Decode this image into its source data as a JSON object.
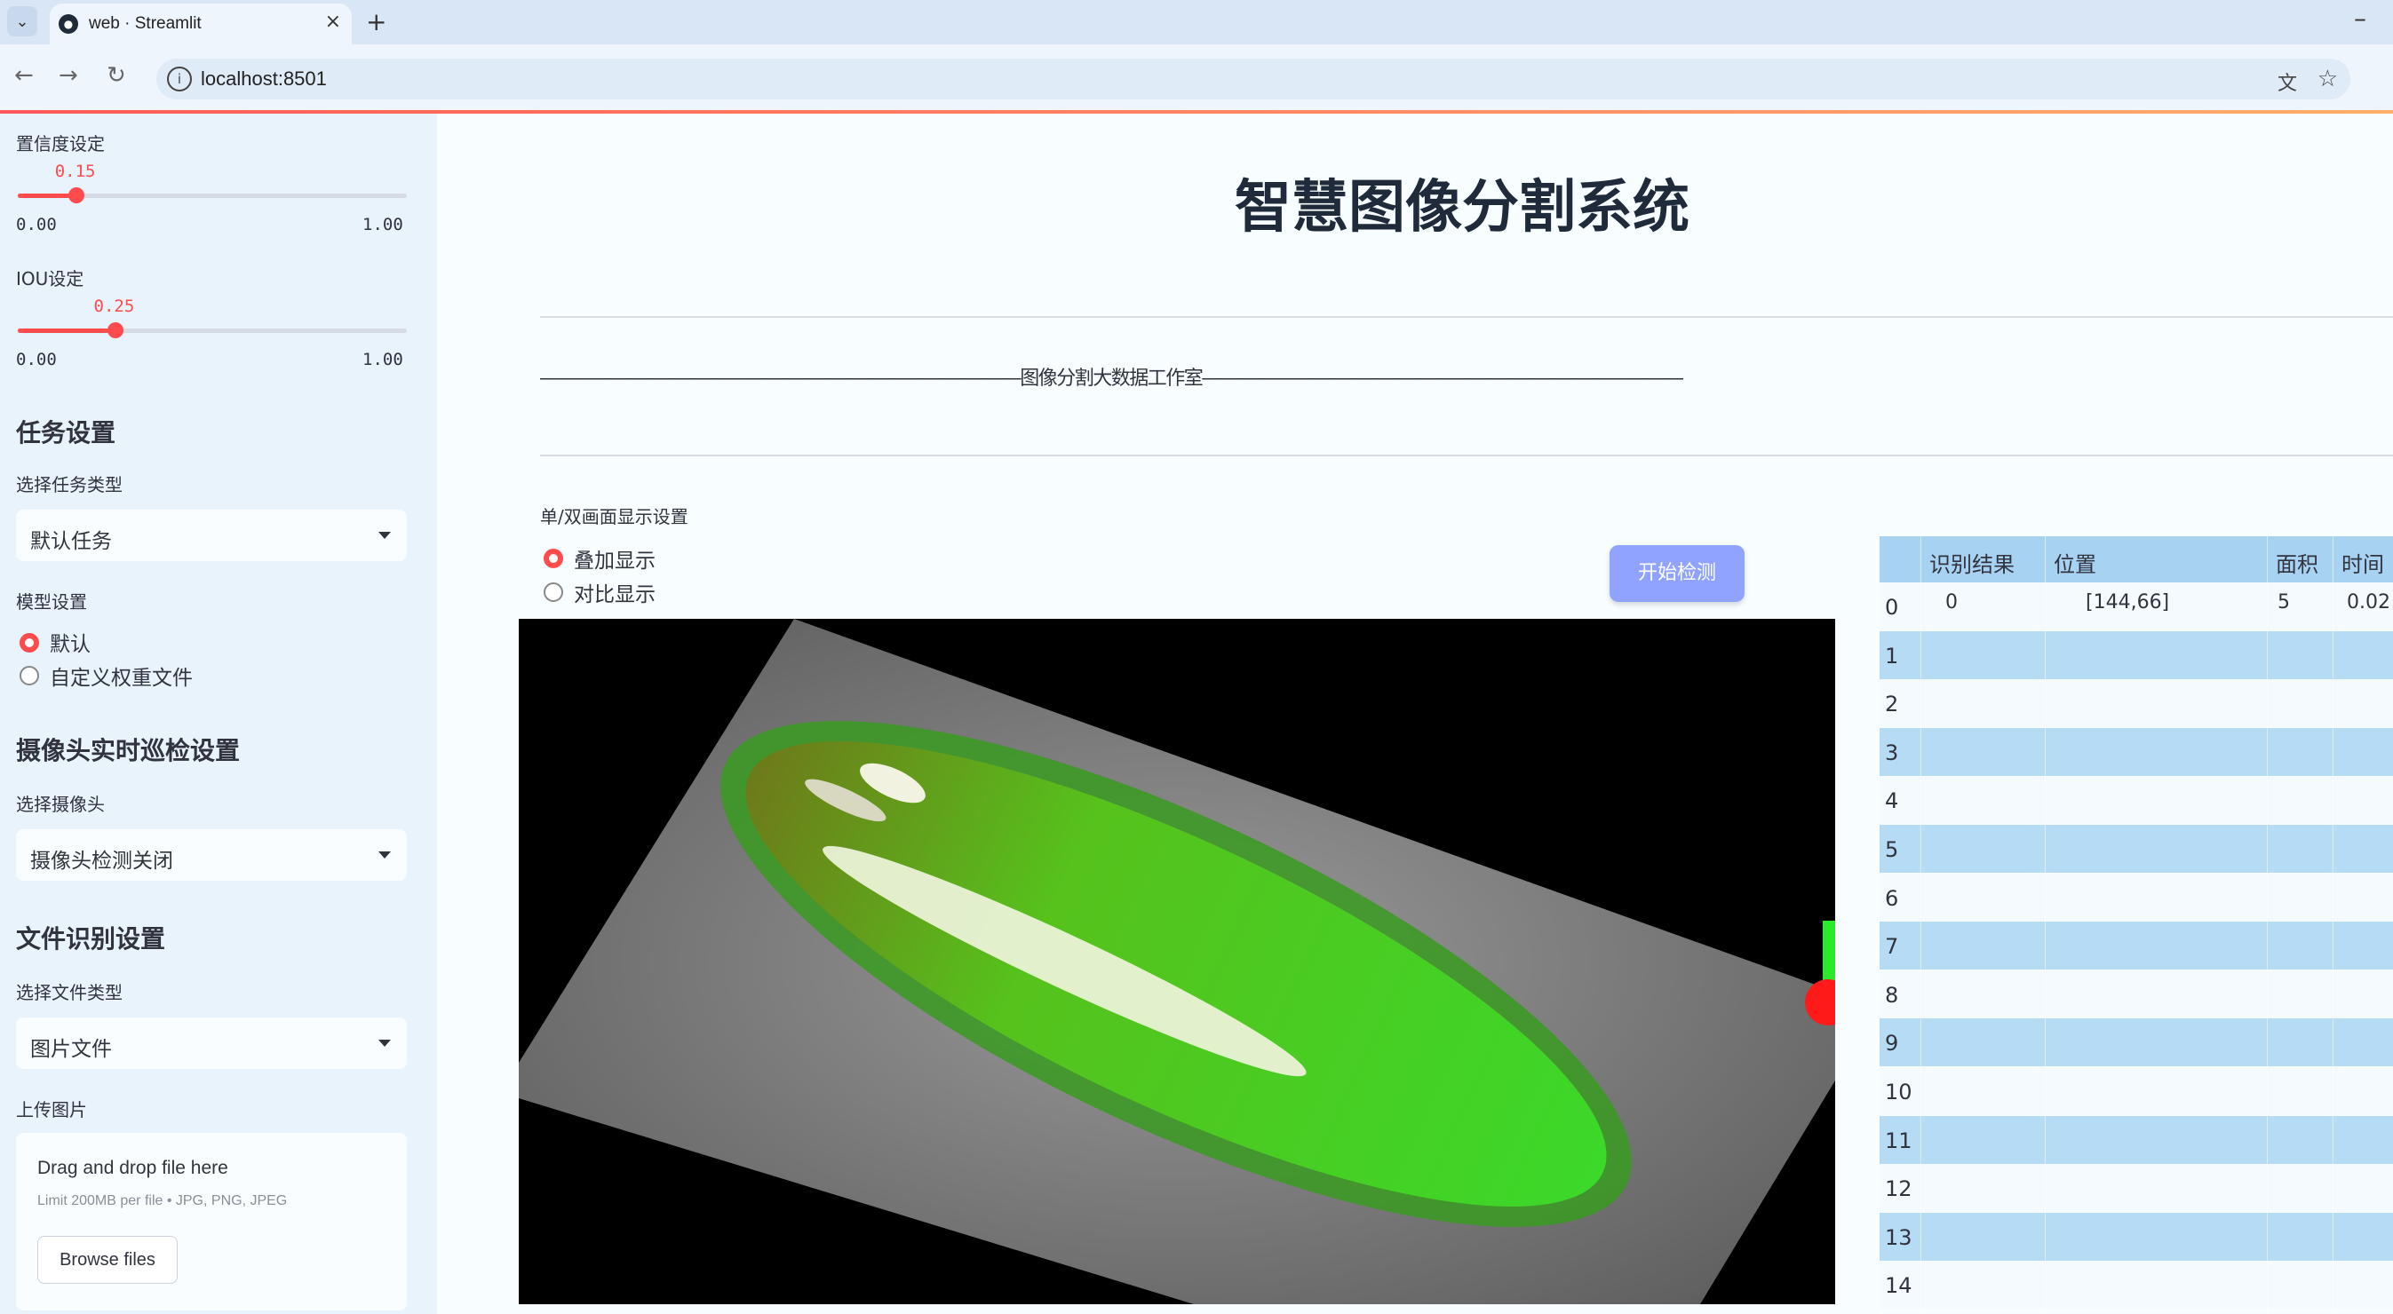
{
  "browser": {
    "tab_title": "web · Streamlit",
    "url": "localhost:8501"
  },
  "sidebar": {
    "conf_label": "置信度设定",
    "conf_value": "0.15",
    "conf_min": "0.00",
    "conf_max": "1.00",
    "conf_fraction": 0.15,
    "iou_label": "IOU设定",
    "iou_value": "0.25",
    "iou_min": "0.00",
    "iou_max": "1.00",
    "iou_fraction": 0.25,
    "task_heading": "任务设置",
    "task_type_label": "选择任务类型",
    "task_type_value": "默认任务",
    "model_label": "模型设置",
    "model_option_default": "默认",
    "model_option_custom": "自定义权重文件",
    "camera_heading": "摄像头实时巡检设置",
    "camera_label": "选择摄像头",
    "camera_value": "摄像头检测关闭",
    "file_heading": "文件识别设置",
    "file_type_label": "选择文件类型",
    "file_type_value": "图片文件",
    "upload_label": "上传图片",
    "upload_title": "Drag and drop file here",
    "upload_sub": "Limit 200MB per file • JPG, PNG, JPEG",
    "upload_button": "Browse files"
  },
  "main": {
    "title": "智慧图像分割系统",
    "studio_line": "——————————————————————————————————————————————图像分割大数据工作室——————————————————————————————————————————————",
    "display_label": "单/双画面显示设置",
    "display_option_overlay": "叠加显示",
    "display_option_compare": "对比显示",
    "start_button": "开始检测"
  },
  "colors": {
    "accent": "#ff4b4b",
    "button": "#8fa3ff",
    "sidebar_bg": "#e8f3fc",
    "table_header": "#a8d2f2",
    "table_row_alt": "#b6dbf5"
  },
  "table": {
    "headers": [
      "识别结果",
      "位置",
      "面积",
      "时间"
    ],
    "rows": [
      {
        "idx": "0",
        "cells": [
          "0",
          "[144,66]",
          "5",
          "0.02"
        ]
      },
      {
        "idx": "1",
        "cells": [
          "",
          "",
          "",
          ""
        ]
      },
      {
        "idx": "2",
        "cells": [
          "",
          "",
          "",
          ""
        ]
      },
      {
        "idx": "3",
        "cells": [
          "",
          "",
          "",
          ""
        ]
      },
      {
        "idx": "4",
        "cells": [
          "",
          "",
          "",
          ""
        ]
      },
      {
        "idx": "5",
        "cells": [
          "",
          "",
          "",
          ""
        ]
      },
      {
        "idx": "6",
        "cells": [
          "",
          "",
          "",
          ""
        ]
      },
      {
        "idx": "7",
        "cells": [
          "",
          "",
          "",
          ""
        ]
      },
      {
        "idx": "8",
        "cells": [
          "",
          "",
          "",
          ""
        ]
      },
      {
        "idx": "9",
        "cells": [
          "",
          "",
          "",
          ""
        ]
      },
      {
        "idx": "10",
        "cells": [
          "",
          "",
          "",
          ""
        ]
      },
      {
        "idx": "11",
        "cells": [
          "",
          "",
          "",
          ""
        ]
      },
      {
        "idx": "12",
        "cells": [
          "",
          "",
          "",
          ""
        ]
      },
      {
        "idx": "13",
        "cells": [
          "",
          "",
          "",
          ""
        ]
      },
      {
        "idx": "14",
        "cells": [
          "",
          "",
          "",
          ""
        ]
      }
    ]
  }
}
